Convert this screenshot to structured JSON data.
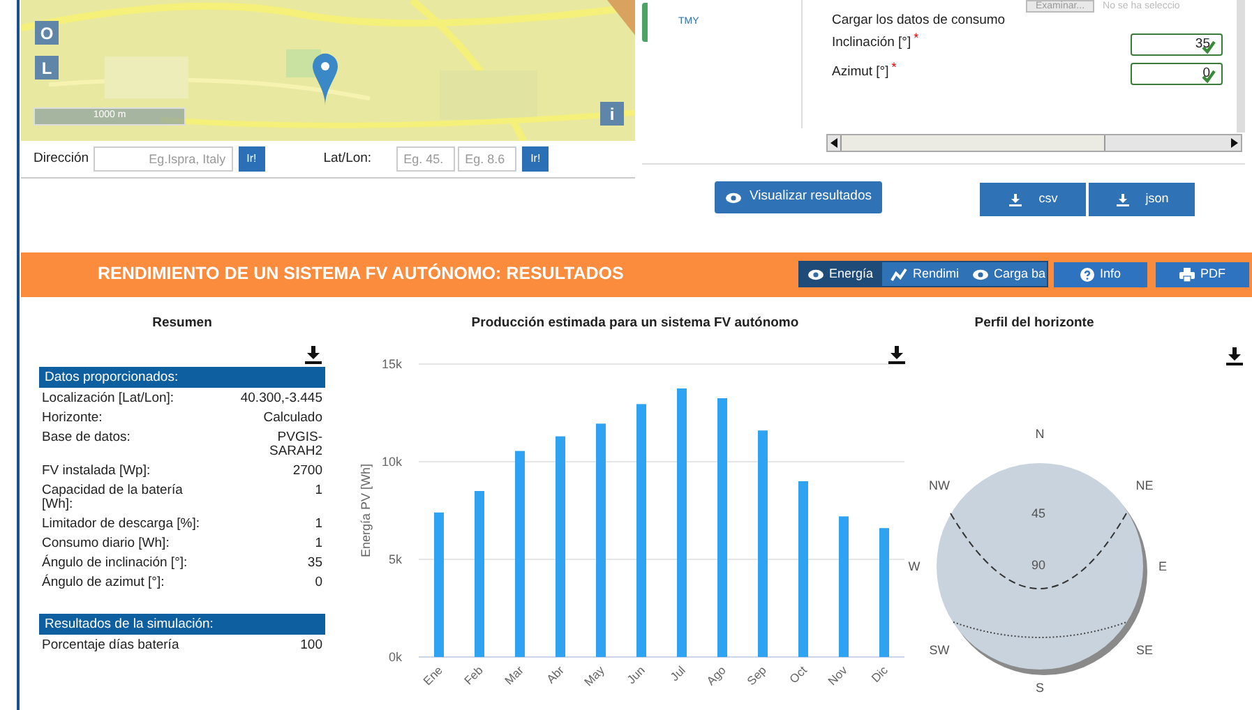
{
  "map": {
    "kind": "picture",
    "buttons": [
      "O",
      "L"
    ],
    "info_button": "i",
    "scale": "1000 m"
  },
  "address_bar": {
    "address_label": "Dirección",
    "address_placeholder": "Eg.Ispra, Italy",
    "go_button": "Ir!",
    "latlon_label": "Lat/Lon:",
    "lat_placeholder": "Eg. 45.",
    "lon_placeholder": "Eg. 8.6",
    "latlon_go_button": "Ir!"
  },
  "tabs": [
    {
      "label": "TMY",
      "selected": true
    }
  ],
  "form": {
    "file_button": "Examinar...",
    "file_status": "No se ha seleccio",
    "consumption_label": "Cargar los datos de consumo",
    "fields": [
      {
        "label": "Inclinación [°]",
        "required_mark": "*",
        "value": "35",
        "valid": true
      },
      {
        "label": "Azimut [°]",
        "required_mark": "*",
        "value": "0",
        "valid": true
      }
    ]
  },
  "actions": {
    "view_button": "Visualizar resultados",
    "downloads": [
      "csv",
      "json"
    ]
  },
  "results_header": {
    "title": "RENDIMIENTO DE UN SISTEMA FV AUTÓNOMO: RESULTADOS",
    "view_tabs": [
      {
        "label": "Energía",
        "selected": true
      },
      {
        "label": "Rendimi",
        "selected": false
      },
      {
        "label": "Carga ba",
        "selected": false
      }
    ],
    "buttons": [
      {
        "label": "Info"
      },
      {
        "label": "PDF"
      }
    ]
  },
  "summary": {
    "title": "Resumen",
    "sections": [
      {
        "heading": "Datos proporcionados:",
        "rows": [
          {
            "label": "Localización [Lat/Lon]:",
            "value": "40.300,-3.445"
          },
          {
            "label": "Horizonte:",
            "value": "Calculado"
          },
          {
            "label": "Base de datos:",
            "value": "PVGIS-SARAH2"
          },
          {
            "label": "FV instalada [Wp]:",
            "value": "2700"
          },
          {
            "label": "Capacidad de la batería [Wh]:",
            "value": "1"
          },
          {
            "label": "Limitador de descarga [%]:",
            "value": "1"
          },
          {
            "label": "Consumo diario [Wh]:",
            "value": "1"
          },
          {
            "label": "Ángulo de inclinación [°]:",
            "value": "35"
          },
          {
            "label": "Ángulo de azimut [°]:",
            "value": "0"
          }
        ]
      },
      {
        "heading": "Resultados de la simulación:",
        "rows": [
          {
            "label": "Porcentaje días batería",
            "value": "100"
          }
        ]
      }
    ]
  },
  "production": {
    "title": "Producción estimada para un sistema FV autónomo",
    "chart_data": {
      "type": "bar",
      "ylabel": "Energía PV [Wh]",
      "categories": [
        "Ene",
        "Feb",
        "Mar",
        "Abr",
        "May",
        "Jun",
        "Jul",
        "Ago",
        "Sep",
        "Oct",
        "Nov",
        "Dic"
      ],
      "series": [
        {
          "color": "#2ea3f2",
          "values": [
            7400,
            8500,
            10550,
            11300,
            11950,
            12950,
            13750,
            13250,
            11600,
            9000,
            7200,
            6600
          ]
        }
      ],
      "ylim": [
        0,
        15000
      ],
      "yticks": [
        {
          "value": 0,
          "label": "0k"
        },
        {
          "value": 5000,
          "label": "5k"
        },
        {
          "value": 10000,
          "label": "10k"
        },
        {
          "value": 15000,
          "label": "15k"
        }
      ]
    }
  },
  "horizon": {
    "title": "Perfil del horizonte",
    "directions": [
      "N",
      "NE",
      "E",
      "SE",
      "S",
      "SW",
      "W",
      "NW"
    ],
    "rings": [
      "45",
      "90"
    ]
  }
}
